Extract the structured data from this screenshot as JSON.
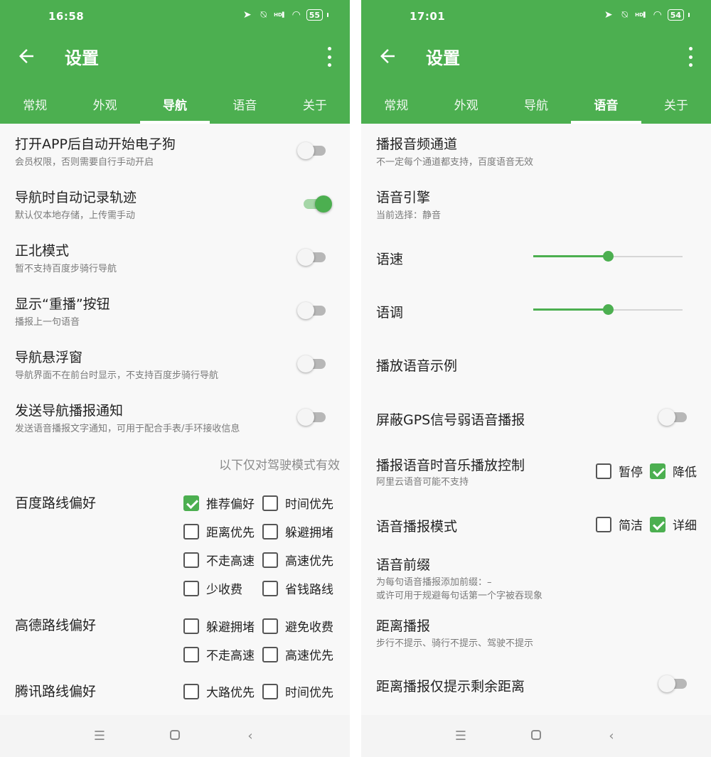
{
  "colors": {
    "primary": "#4caf50",
    "background": "#f8f8f8"
  },
  "left": {
    "status": {
      "time": "16:58",
      "battery": "55",
      "icons": [
        "location-icon",
        "mute-icon",
        "signal-icon",
        "wifi-icon"
      ]
    },
    "header": {
      "title": "设置"
    },
    "tabs": [
      {
        "label": "常规",
        "active": false
      },
      {
        "label": "外观",
        "active": false
      },
      {
        "label": "导航",
        "active": true
      },
      {
        "label": "语音",
        "active": false
      },
      {
        "label": "关于",
        "active": false
      }
    ],
    "settings": [
      {
        "title": "打开APP后自动开始电子狗",
        "subtitle": "会员权限，否则需要自行手动开启",
        "toggle": false
      },
      {
        "title": "导航时自动记录轨迹",
        "subtitle": "默认仅本地存储，上传需手动",
        "toggle": true
      },
      {
        "title": "正北模式",
        "subtitle": "暂不支持百度步骑行导航",
        "toggle": false
      },
      {
        "title": "显示“重播”按钮",
        "subtitle": "播报上一句语音",
        "toggle": false
      },
      {
        "title": "导航悬浮窗",
        "subtitle": "导航界面不在前台时显示，不支持百度步骑行导航",
        "toggle": false
      },
      {
        "title": "发送导航播报通知",
        "subtitle": "发送语音播报文字通知，可用于配合手表/手环接收信息",
        "toggle": false
      }
    ],
    "driving_note": "以下仅对驾驶模式有效",
    "route_prefs": [
      {
        "label": "百度路线偏好",
        "options": [
          {
            "label": "推荐偏好",
            "checked": true
          },
          {
            "label": "时间优先",
            "checked": false
          },
          {
            "label": "距离优先",
            "checked": false
          },
          {
            "label": "躲避拥堵",
            "checked": false
          },
          {
            "label": "不走高速",
            "checked": false
          },
          {
            "label": "高速优先",
            "checked": false
          },
          {
            "label": "少收费",
            "checked": false
          },
          {
            "label": "省钱路线",
            "checked": false
          }
        ]
      },
      {
        "label": "高德路线偏好",
        "options": [
          {
            "label": "躲避拥堵",
            "checked": false
          },
          {
            "label": "避免收费",
            "checked": false
          },
          {
            "label": "不走高速",
            "checked": false
          },
          {
            "label": "高速优先",
            "checked": false
          }
        ]
      },
      {
        "label": "腾讯路线偏好",
        "options": [
          {
            "label": "大路优先",
            "checked": false
          },
          {
            "label": "时间优先",
            "checked": false
          }
        ]
      }
    ]
  },
  "right": {
    "status": {
      "time": "17:01",
      "battery": "54",
      "icons": [
        "location-icon",
        "mute-icon",
        "signal-icon",
        "wifi-icon"
      ]
    },
    "header": {
      "title": "设置"
    },
    "tabs": [
      {
        "label": "常规",
        "active": false
      },
      {
        "label": "外观",
        "active": false
      },
      {
        "label": "导航",
        "active": false
      },
      {
        "label": "语音",
        "active": true
      },
      {
        "label": "关于",
        "active": false
      }
    ],
    "audio_channel": {
      "title": "播报音频通道",
      "subtitle": "不一定每个通道都支持，百度语音无效"
    },
    "voice_engine": {
      "title": "语音引擎",
      "subtitle": "当前选择：静音"
    },
    "speech_rate": {
      "label": "语速",
      "value": 0.5
    },
    "pitch": {
      "label": "语调",
      "value": 0.5
    },
    "play_sample": {
      "title": "播放语音示例"
    },
    "mute_weak_gps": {
      "title": "屏蔽GPS信号弱语音播报",
      "toggle": false
    },
    "music_control": {
      "title": "播报语音时音乐播放控制",
      "subtitle": "阿里云语音可能不支持",
      "options": [
        {
          "label": "暂停",
          "checked": false
        },
        {
          "label": "降低",
          "checked": true
        }
      ]
    },
    "broadcast_mode": {
      "title": "语音播报模式",
      "options": [
        {
          "label": "简洁",
          "checked": false
        },
        {
          "label": "详细",
          "checked": true
        }
      ]
    },
    "prefix": {
      "title": "语音前缀",
      "subtitle": "为每句语音播报添加前缀：–",
      "subtitle2": "或许可用于规避每句话第一个字被吞现象"
    },
    "distance_broadcast": {
      "title": "距离播报",
      "subtitle": "步行不提示、骑行不提示、驾驶不提示"
    },
    "distance_remaining": {
      "title": "距离播报仅提示剩余距离",
      "toggle": false
    }
  },
  "navbar": {
    "icons": [
      "menu-icon",
      "home-icon",
      "back-nav-icon"
    ]
  }
}
